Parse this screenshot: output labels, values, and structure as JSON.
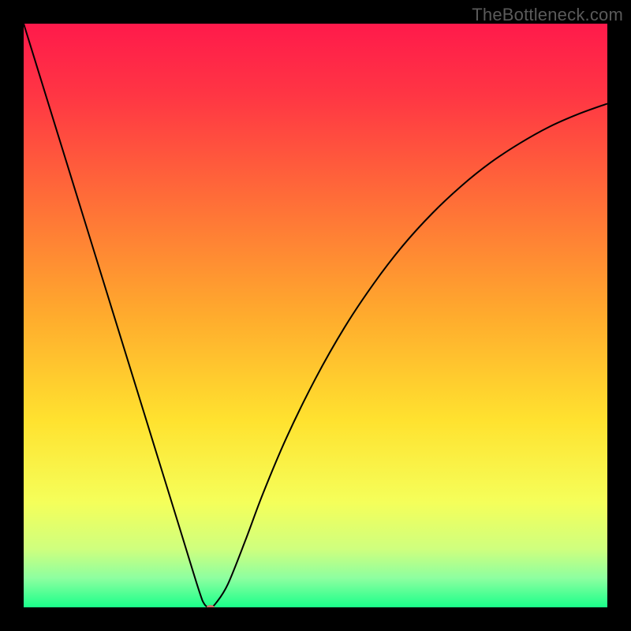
{
  "watermark": "TheBottleneck.com",
  "chart_data": {
    "type": "line",
    "title": "",
    "xlabel": "",
    "ylabel": "",
    "xlim": [
      0,
      100
    ],
    "ylim": [
      0,
      100
    ],
    "grid": false,
    "legend": false,
    "background": {
      "type": "vertical-gradient",
      "stops": [
        {
          "pos": 0.0,
          "color": "#ff1a4b"
        },
        {
          "pos": 0.12,
          "color": "#ff3544"
        },
        {
          "pos": 0.3,
          "color": "#ff6d38"
        },
        {
          "pos": 0.5,
          "color": "#ffab2d"
        },
        {
          "pos": 0.68,
          "color": "#ffe22f"
        },
        {
          "pos": 0.82,
          "color": "#f5ff5a"
        },
        {
          "pos": 0.9,
          "color": "#cfff7e"
        },
        {
          "pos": 0.95,
          "color": "#8dffa0"
        },
        {
          "pos": 1.0,
          "color": "#1aff8a"
        }
      ]
    },
    "series": [
      {
        "name": "curve",
        "color": "#000000",
        "stroke_width": 2,
        "x": [
          0,
          3,
          6,
          9,
          12,
          15,
          18,
          21,
          24,
          27,
          30,
          31,
          32,
          33,
          35,
          38,
          41,
          45,
          50,
          55,
          60,
          65,
          70,
          75,
          80,
          85,
          90,
          95,
          100
        ],
        "y": [
          100,
          90.3,
          80.6,
          70.9,
          61.2,
          51.5,
          41.8,
          32.1,
          22.4,
          12.7,
          3.0,
          0.5,
          0.0,
          0.8,
          4.0,
          11.5,
          19.5,
          29.0,
          39.2,
          48.0,
          55.5,
          62.0,
          67.5,
          72.2,
          76.2,
          79.5,
          82.3,
          84.5,
          86.3
        ]
      }
    ],
    "markers": [
      {
        "name": "minimum-marker",
        "x": 32,
        "y": 0,
        "color": "#d3776c",
        "rx": 5,
        "ry": 3
      }
    ]
  }
}
